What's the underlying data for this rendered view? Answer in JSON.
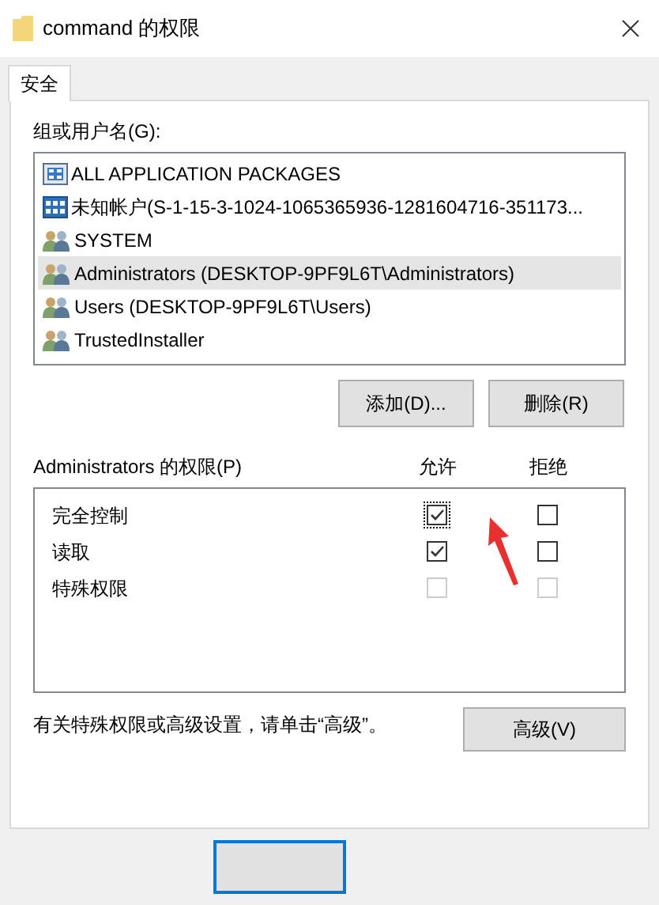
{
  "window": {
    "title": "command 的权限"
  },
  "tabs": [
    {
      "label": "安全",
      "selected": true
    }
  ],
  "group_label": "组或用户名(G):",
  "principals": [
    {
      "name": "ALL APPLICATION PACKAGES",
      "kind": "package",
      "selected": false
    },
    {
      "name": "未知帐户(S-1-15-3-1024-1065365936-1281604716-351173...",
      "kind": "account",
      "selected": false
    },
    {
      "name": "SYSTEM",
      "kind": "group",
      "selected": false
    },
    {
      "name": "Administrators (DESKTOP-9PF9L6T\\Administrators)",
      "kind": "group",
      "selected": true
    },
    {
      "name": "Users (DESKTOP-9PF9L6T\\Users)",
      "kind": "group",
      "selected": false
    },
    {
      "name": "TrustedInstaller",
      "kind": "group",
      "selected": false
    }
  ],
  "principal_buttons": [
    "添加(D)...",
    "删除(R)"
  ],
  "permissions_label": "Administrators 的权限(P)",
  "columns": [
    "允许",
    "拒绝"
  ],
  "permissions": [
    {
      "name": "完全控制",
      "allow": {
        "checked": true,
        "disabled": false,
        "focused": true
      },
      "deny": {
        "checked": false,
        "disabled": false,
        "focused": false
      }
    },
    {
      "name": "读取",
      "allow": {
        "checked": true,
        "disabled": false,
        "focused": false
      },
      "deny": {
        "checked": false,
        "disabled": false,
        "focused": false
      }
    },
    {
      "name": "特殊权限",
      "allow": {
        "checked": false,
        "disabled": true,
        "focused": false
      },
      "deny": {
        "checked": false,
        "disabled": true,
        "focused": false
      }
    }
  ],
  "advanced_hint": "有关特殊权限或高级设置，请单击“高级”。",
  "advanced_button": "高级(V)",
  "footer_buttons": [
    {
      "default": true
    }
  ]
}
